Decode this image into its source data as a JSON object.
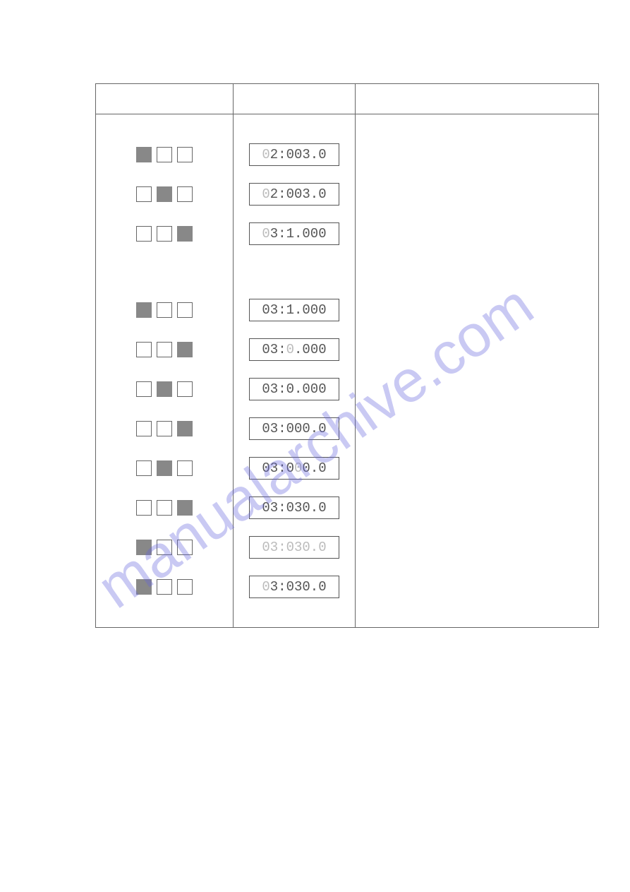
{
  "watermark": "manualarchive.com",
  "rows": [
    {
      "boxes": [
        true,
        false,
        false
      ],
      "lcd": "02:003.0",
      "ghost": "0"
    },
    {
      "boxes": [
        false,
        true,
        false
      ],
      "lcd": "02:003.0",
      "ghost": "2"
    },
    {
      "boxes": [
        false,
        false,
        true
      ],
      "lcd": "03:1.000",
      "ghost": "3"
    },
    {
      "boxes": [
        true,
        false,
        false
      ],
      "lcd": "03:1.000"
    },
    {
      "boxes": [
        false,
        false,
        true
      ],
      "lcd": "03:0.000",
      "ghost_char_index": 3
    },
    {
      "boxes": [
        false,
        true,
        false
      ],
      "lcd": "03:0.000"
    },
    {
      "boxes": [
        false,
        false,
        true
      ],
      "lcd": "03:000.0"
    },
    {
      "boxes": [
        false,
        true,
        false
      ],
      "lcd": "03:000.0",
      "ghost_char_index": 4
    },
    {
      "boxes": [
        false,
        false,
        true
      ],
      "lcd": "03:030.0"
    },
    {
      "boxes": [
        true,
        false,
        false
      ],
      "lcd": "03:030.0",
      "ghost_all": true
    },
    {
      "boxes": [
        true,
        false,
        false
      ],
      "lcd": "03:030.0",
      "ghost": "0"
    }
  ],
  "groups": [
    [
      0,
      1,
      2
    ],
    [
      3,
      4,
      5,
      6,
      7,
      8,
      9,
      10
    ]
  ]
}
